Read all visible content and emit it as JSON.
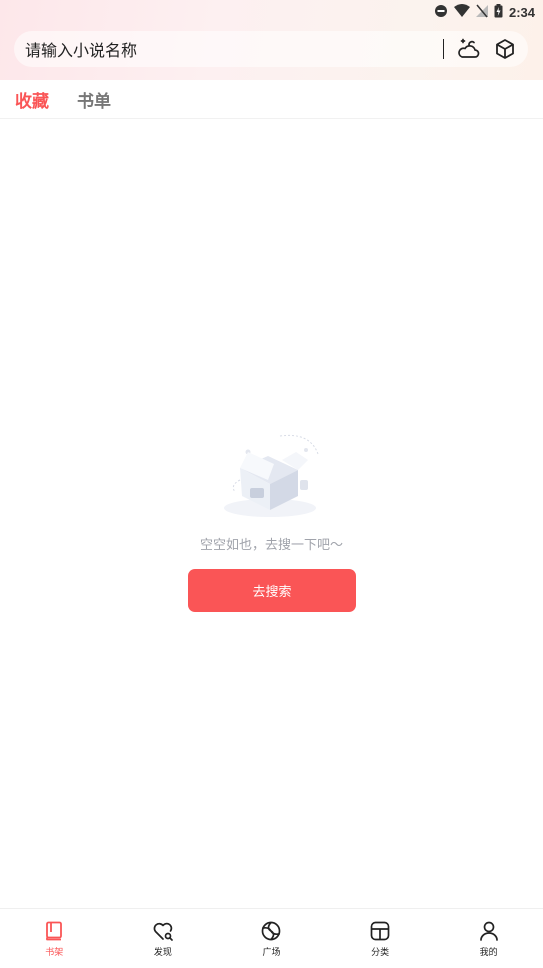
{
  "status_bar": {
    "time": "2:34"
  },
  "search": {
    "placeholder": "请输入小说名称"
  },
  "tabs": [
    {
      "label": "收藏",
      "active": true
    },
    {
      "label": "书单",
      "active": false
    }
  ],
  "empty_state": {
    "message": "空空如也，去搜一下吧～",
    "button_label": "去搜索"
  },
  "bottom_nav": [
    {
      "label": "书架",
      "icon": "bookshelf-icon",
      "active": true
    },
    {
      "label": "发现",
      "icon": "discover-icon",
      "active": false
    },
    {
      "label": "广场",
      "icon": "plaza-icon",
      "active": false
    },
    {
      "label": "分类",
      "icon": "category-icon",
      "active": false
    },
    {
      "label": "我的",
      "icon": "profile-icon",
      "active": false
    }
  ],
  "colors": {
    "accent": "#fa5556",
    "muted_text": "#a0a3ab"
  }
}
